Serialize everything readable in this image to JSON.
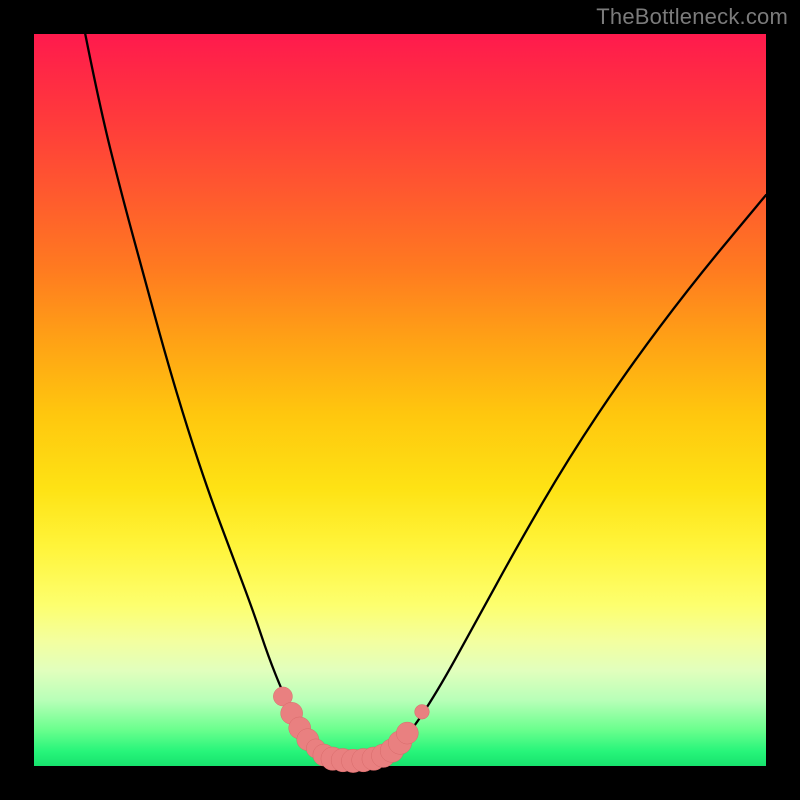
{
  "watermark": "TheBottleneck.com",
  "colors": {
    "frame": "#000000",
    "curve_stroke": "#000000",
    "marker_fill": "#e98080",
    "marker_stroke": "#d86a6a"
  },
  "chart_data": {
    "type": "line",
    "title": "",
    "xlabel": "",
    "ylabel": "",
    "xlim": [
      0,
      100
    ],
    "ylim": [
      0,
      100
    ],
    "grid": false,
    "series": [
      {
        "name": "left-curve",
        "x": [
          7,
          9,
          12,
          15,
          18,
          21,
          24,
          27,
          30,
          32,
          34,
          35.5,
          37,
          38.5,
          40
        ],
        "y": [
          100,
          90,
          78,
          67,
          56,
          46,
          37,
          29,
          21,
          15,
          10,
          7,
          4.5,
          2.5,
          1.2
        ]
      },
      {
        "name": "floor",
        "x": [
          40,
          44,
          48
        ],
        "y": [
          1.2,
          0.8,
          1.2
        ]
      },
      {
        "name": "right-curve",
        "x": [
          48,
          51,
          55,
          60,
          66,
          73,
          81,
          90,
          100
        ],
        "y": [
          1.2,
          4,
          10,
          19,
          30,
          42,
          54,
          66,
          78
        ]
      }
    ],
    "markers": [
      {
        "x": 34.0,
        "y": 9.5,
        "r": 1.3
      },
      {
        "x": 35.2,
        "y": 7.2,
        "r": 1.5
      },
      {
        "x": 36.3,
        "y": 5.2,
        "r": 1.5
      },
      {
        "x": 37.4,
        "y": 3.6,
        "r": 1.5
      },
      {
        "x": 38.5,
        "y": 2.4,
        "r": 1.3
      },
      {
        "x": 39.6,
        "y": 1.5,
        "r": 1.5
      },
      {
        "x": 40.8,
        "y": 1.0,
        "r": 1.6
      },
      {
        "x": 42.2,
        "y": 0.8,
        "r": 1.6
      },
      {
        "x": 43.6,
        "y": 0.7,
        "r": 1.6
      },
      {
        "x": 45.0,
        "y": 0.8,
        "r": 1.6
      },
      {
        "x": 46.4,
        "y": 1.0,
        "r": 1.6
      },
      {
        "x": 47.7,
        "y": 1.4,
        "r": 1.6
      },
      {
        "x": 48.9,
        "y": 2.1,
        "r": 1.6
      },
      {
        "x": 50.0,
        "y": 3.2,
        "r": 1.6
      },
      {
        "x": 51.0,
        "y": 4.5,
        "r": 1.5
      },
      {
        "x": 53.0,
        "y": 7.4,
        "r": 1.0
      }
    ]
  }
}
